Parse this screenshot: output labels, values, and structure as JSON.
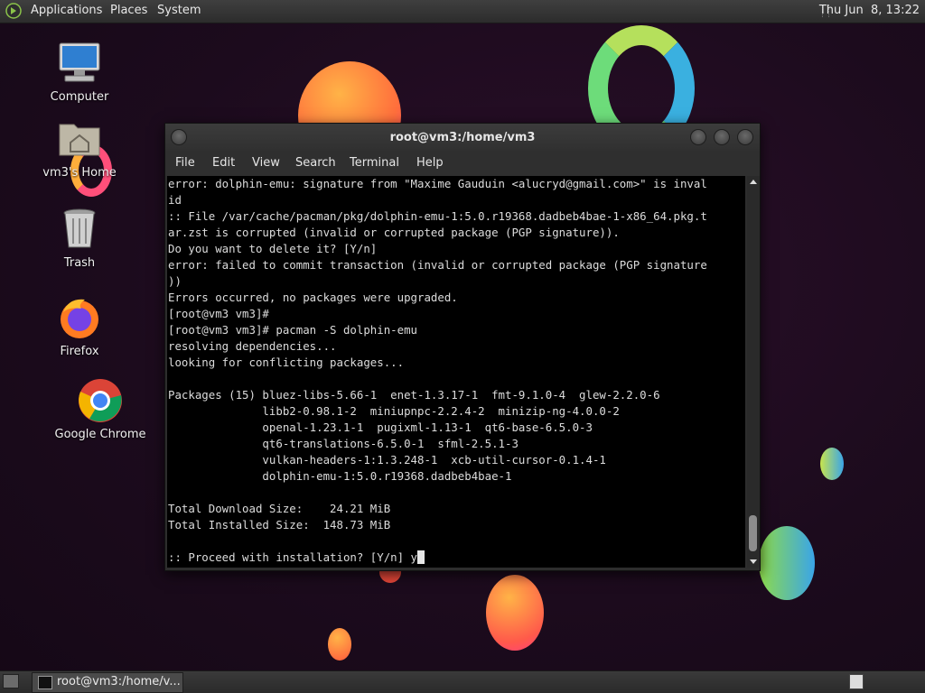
{
  "top_panel": {
    "menus": [
      "Applications",
      "Places",
      "System"
    ],
    "clock": "Thu Jun  8, 13:22"
  },
  "desktop": {
    "icons": [
      {
        "label": "Computer",
        "icon": "computer-icon"
      },
      {
        "label": "vm3's Home",
        "icon": "home-folder-icon"
      },
      {
        "label": "Trash",
        "icon": "trash-icon"
      },
      {
        "label": "Firefox",
        "icon": "firefox-icon"
      },
      {
        "label": "Google Chrome",
        "icon": "chrome-icon"
      }
    ]
  },
  "terminal": {
    "title": "root@vm3:/home/vm3",
    "menu": [
      "File",
      "Edit",
      "View",
      "Search",
      "Terminal",
      "Help"
    ],
    "lines": [
      "error: dolphin-emu: signature from \"Maxime Gauduin <alucryd@gmail.com>\" is inval",
      "id",
      ":: File /var/cache/pacman/pkg/dolphin-emu-1:5.0.r19368.dadbeb4bae-1-x86_64.pkg.t",
      "ar.zst is corrupted (invalid or corrupted package (PGP signature)).",
      "Do you want to delete it? [Y/n]",
      "error: failed to commit transaction (invalid or corrupted package (PGP signature",
      "))",
      "Errors occurred, no packages were upgraded.",
      "[root@vm3 vm3]#",
      "[root@vm3 vm3]# pacman -S dolphin-emu",
      "resolving dependencies...",
      "looking for conflicting packages...",
      "",
      "Packages (15) bluez-libs-5.66-1  enet-1.3.17-1  fmt-9.1.0-4  glew-2.2.0-6",
      "              libb2-0.98.1-2  miniupnpc-2.2.4-2  minizip-ng-4.0.0-2",
      "              openal-1.23.1-1  pugixml-1.13-1  qt6-base-6.5.0-3",
      "              qt6-translations-6.5.0-1  sfml-2.5.1-3",
      "              vulkan-headers-1:1.3.248-1  xcb-util-cursor-0.1.4-1",
      "              dolphin-emu-1:5.0.r19368.dadbeb4bae-1",
      "",
      "Total Download Size:    24.21 MiB",
      "Total Installed Size:  148.73 MiB",
      "",
      ":: Proceed with installation? [Y/n] y"
    ]
  },
  "taskbar": {
    "task_label": "root@vm3:/home/v..."
  }
}
